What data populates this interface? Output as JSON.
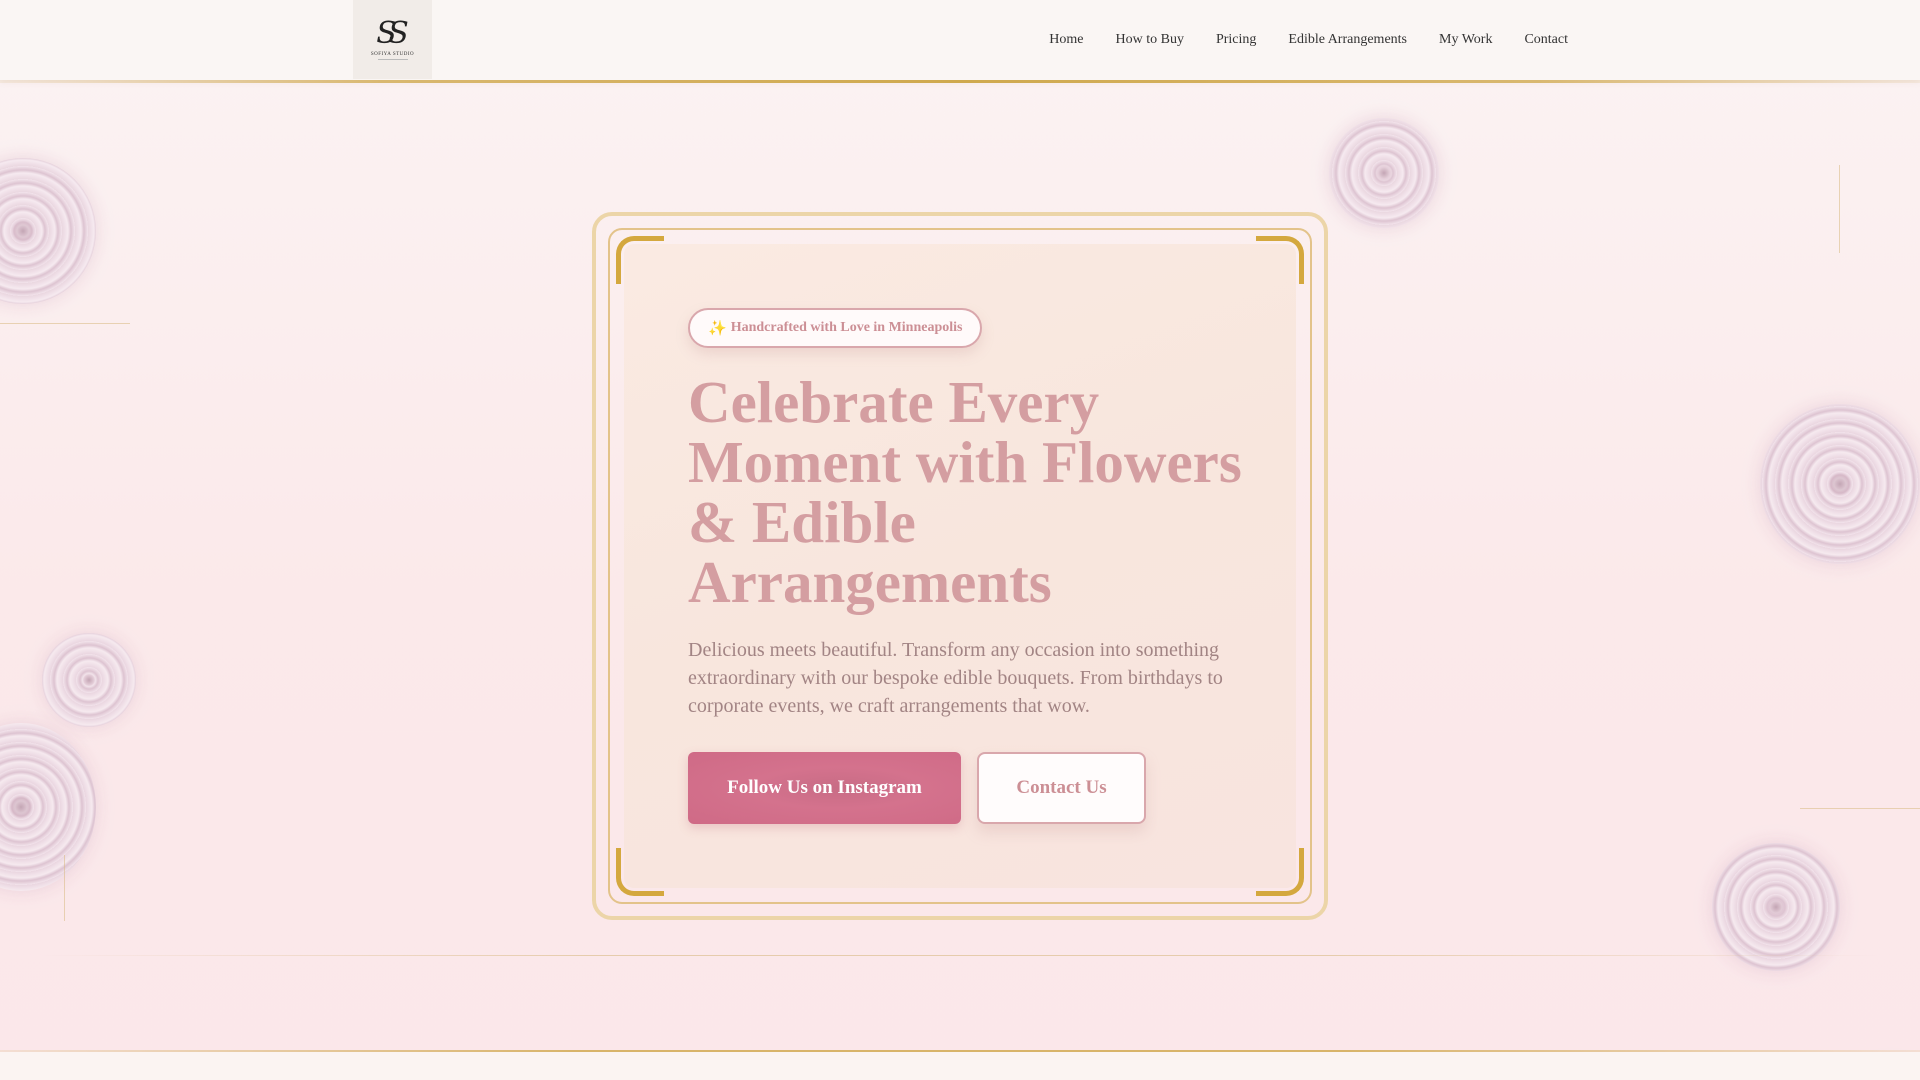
{
  "header": {
    "logo": {
      "mark": "S",
      "text": "SOFIYA STUDIO"
    },
    "nav": [
      {
        "label": "Home"
      },
      {
        "label": "How to Buy"
      },
      {
        "label": "Pricing"
      },
      {
        "label": "Edible Arrangements"
      },
      {
        "label": "My Work"
      },
      {
        "label": "Contact"
      }
    ]
  },
  "hero": {
    "badge_icon": "✨",
    "badge": "Handcrafted with Love in Minneapolis",
    "title": "Celebrate Every Moment with Flowers & Edible Arrangements",
    "description": "Delicious meets beautiful. Transform any occasion into something extraordinary with our bespoke edible bouquets. From birthdays to corporate events, we craft arrangements that wow.",
    "primary_button": "Follow Us on Instagram",
    "secondary_button": "Contact Us"
  },
  "colors": {
    "accent_pink": "#d4728d",
    "title_pink": "#d49ea1",
    "gold": "#d4a83e",
    "background": "#fbecee"
  },
  "icons": [
    "sparkle-icon",
    "rose-decoration-icon",
    "logo-icon"
  ]
}
